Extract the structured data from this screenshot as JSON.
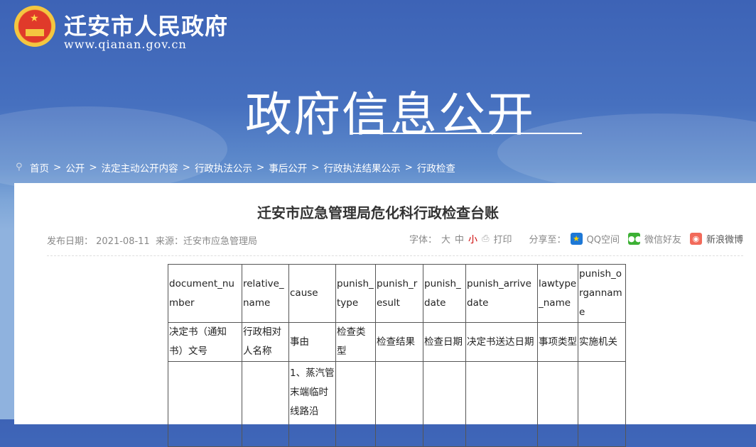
{
  "header": {
    "site_name": "迁安市人民政府",
    "site_url": "www.qianan.gov.cn",
    "banner": "政府信息公开"
  },
  "breadcrumb": [
    "首页",
    "公开",
    "法定主动公开内容",
    "行政执法公示",
    "事后公开",
    "行政执法结果公示",
    "行政检查"
  ],
  "article": {
    "title": "迁安市应急管理局危化科行政检查台账",
    "publish_label": "发布日期：",
    "publish_date": "2021-08-11",
    "source_label": "来源：",
    "source": "迁安市应急管理局"
  },
  "tools": {
    "font_label": "字体：",
    "font_large": "大",
    "font_medium": "中",
    "font_small": "小",
    "print": "打印",
    "share_label": "分享至：",
    "qzone": "QQ空间",
    "wechat": "微信好友",
    "weibo": "新浪微博"
  },
  "table": {
    "header_en": [
      "document_number",
      "relative_name",
      "cause",
      "punish_type",
      "punish_result",
      "punish_date",
      "punish_arrivedate",
      "lawtype_name",
      "punish_organname"
    ],
    "header_cn": [
      "决定书（通知书）文号",
      "行政相对人名称",
      "事由",
      "检查类型",
      "检查结果",
      "检查日期",
      "决定书送达日期",
      "事项类型",
      "实施机关"
    ],
    "rows": [
      [
        "",
        "",
        "1、蒸汽管末端临时线路沿",
        "",
        "",
        "",
        "",
        "",
        ""
      ]
    ]
  }
}
